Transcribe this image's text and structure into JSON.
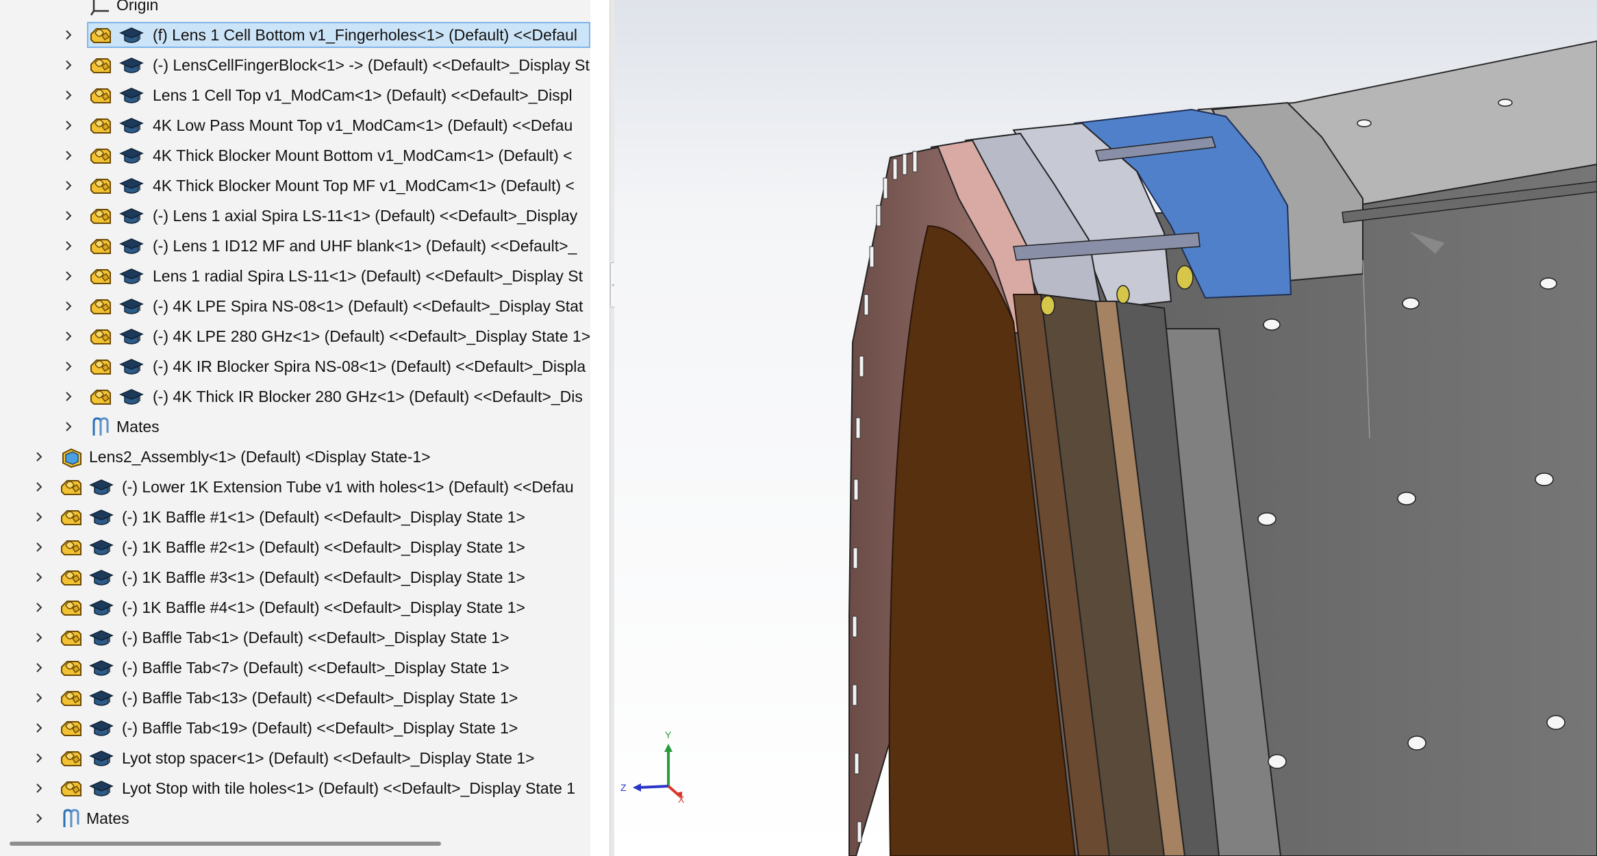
{
  "feature_tree": {
    "rows": [
      {
        "label": "Origin",
        "type": "origin",
        "level": 2,
        "expander": false,
        "selected": false
      },
      {
        "label": "(f) Lens 1 Cell Bottom v1_Fingerholes<1> (Default) <<Defaul",
        "type": "part",
        "level": 2,
        "expander": true,
        "selected": true
      },
      {
        "label": "(-) LensCellFingerBlock<1> -> (Default) <<Default>_Display State",
        "type": "part",
        "level": 2,
        "expander": true,
        "selected": false
      },
      {
        "label": "Lens 1 Cell Top v1_ModCam<1> (Default) <<Default>_Displ",
        "type": "part",
        "level": 2,
        "expander": true,
        "selected": false
      },
      {
        "label": "4K Low Pass Mount Top v1_ModCam<1> (Default) <<Defau",
        "type": "part",
        "level": 2,
        "expander": true,
        "selected": false
      },
      {
        "label": "4K Thick Blocker Mount Bottom v1_ModCam<1> (Default) <",
        "type": "part",
        "level": 2,
        "expander": true,
        "selected": false
      },
      {
        "label": "4K Thick Blocker Mount Top MF v1_ModCam<1> (Default) <",
        "type": "part",
        "level": 2,
        "expander": true,
        "selected": false
      },
      {
        "label": "(-) Lens 1 axial Spira LS-11<1> (Default) <<Default>_Display",
        "type": "part",
        "level": 2,
        "expander": true,
        "selected": false
      },
      {
        "label": "(-) Lens 1 ID12 MF and UHF blank<1> (Default) <<Default>_",
        "type": "part",
        "level": 2,
        "expander": true,
        "selected": false
      },
      {
        "label": "Lens 1 radial Spira LS-11<1> (Default) <<Default>_Display St",
        "type": "part",
        "level": 2,
        "expander": true,
        "selected": false
      },
      {
        "label": "(-) 4K LPE Spira NS-08<1> (Default) <<Default>_Display Stat",
        "type": "part",
        "level": 2,
        "expander": true,
        "selected": false
      },
      {
        "label": "(-) 4K LPE 280 GHz<1> (Default) <<Default>_Display State 1>",
        "type": "part",
        "level": 2,
        "expander": true,
        "selected": false
      },
      {
        "label": "(-) 4K IR Blocker Spira NS-08<1> (Default) <<Default>_Displa",
        "type": "part",
        "level": 2,
        "expander": true,
        "selected": false
      },
      {
        "label": "(-) 4K Thick IR Blocker 280 GHz<1> (Default) <<Default>_Dis",
        "type": "part",
        "level": 2,
        "expander": true,
        "selected": false
      },
      {
        "label": "Mates",
        "type": "mates",
        "level": 2,
        "expander": true,
        "selected": false
      },
      {
        "label": "Lens2_Assembly<1> (Default) <Display State-1>",
        "type": "assembly",
        "level": 1,
        "expander": true,
        "selected": false
      },
      {
        "label": "(-) Lower 1K Extension Tube v1 with holes<1> (Default) <<Defau",
        "type": "part",
        "level": 1,
        "expander": true,
        "selected": false
      },
      {
        "label": "(-) 1K Baffle #1<1> (Default) <<Default>_Display State 1>",
        "type": "part",
        "level": 1,
        "expander": true,
        "selected": false
      },
      {
        "label": "(-) 1K Baffle #2<1> (Default) <<Default>_Display State 1>",
        "type": "part",
        "level": 1,
        "expander": true,
        "selected": false
      },
      {
        "label": "(-) 1K Baffle #3<1> (Default) <<Default>_Display State 1>",
        "type": "part",
        "level": 1,
        "expander": true,
        "selected": false
      },
      {
        "label": "(-) 1K Baffle #4<1> (Default) <<Default>_Display State 1>",
        "type": "part",
        "level": 1,
        "expander": true,
        "selected": false
      },
      {
        "label": "(-) Baffle Tab<1> (Default) <<Default>_Display State 1>",
        "type": "part",
        "level": 1,
        "expander": true,
        "selected": false
      },
      {
        "label": "(-) Baffle Tab<7> (Default) <<Default>_Display State 1>",
        "type": "part",
        "level": 1,
        "expander": true,
        "selected": false
      },
      {
        "label": "(-) Baffle Tab<13> (Default) <<Default>_Display State 1>",
        "type": "part",
        "level": 1,
        "expander": true,
        "selected": false
      },
      {
        "label": "(-) Baffle Tab<19> (Default) <<Default>_Display State 1>",
        "type": "part",
        "level": 1,
        "expander": true,
        "selected": false
      },
      {
        "label": "Lyot stop spacer<1> (Default) <<Default>_Display State 1>",
        "type": "part",
        "level": 1,
        "expander": true,
        "selected": false
      },
      {
        "label": "Lyot Stop with tile holes<1> (Default) <<Default>_Display State 1",
        "type": "part",
        "level": 1,
        "expander": true,
        "selected": false
      },
      {
        "label": "Mates",
        "type": "mates",
        "level": 1,
        "expander": true,
        "selected": false
      }
    ]
  },
  "triad": {
    "x": "X",
    "y": "Y",
    "z": "Z"
  },
  "colors": {
    "tree_bg": "#f3f3f3",
    "selection_fill": "#cce4f7",
    "selection_border": "#7eb4ea",
    "part_icon": "#f2c232",
    "body_gray": "#6e6e6e",
    "ring_blue": "#4d7fc8",
    "ring_copper": "#b68a84",
    "lens_brown": "#5a3010",
    "triad_x": "#d8382c",
    "triad_y": "#2a9a3a",
    "triad_z": "#2a36c8"
  }
}
